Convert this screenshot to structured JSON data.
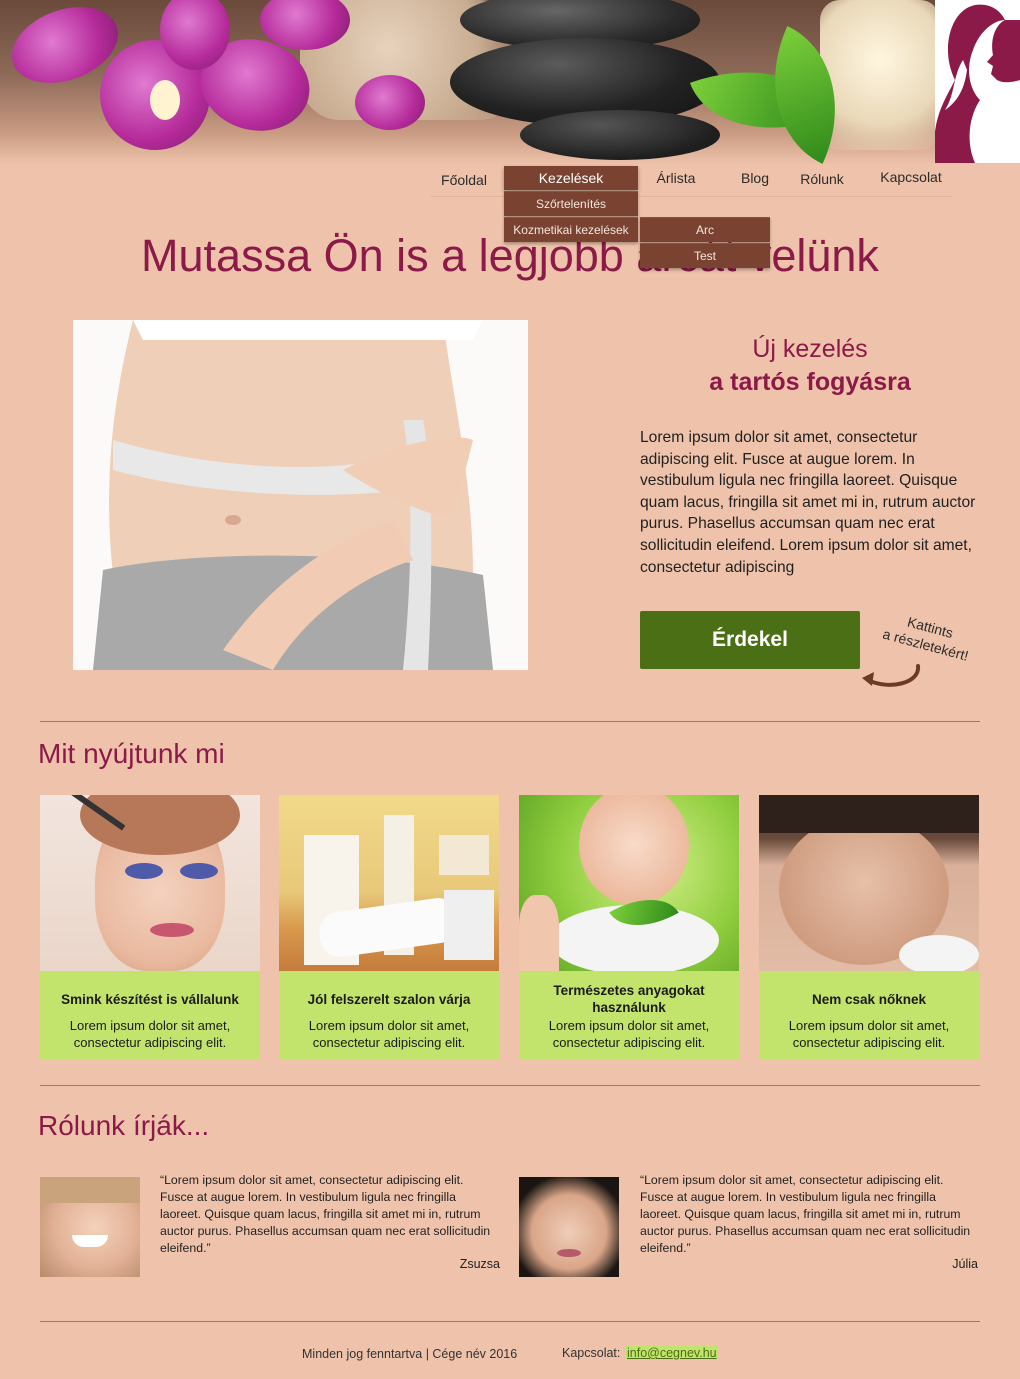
{
  "nav": {
    "items": [
      {
        "label": "Főoldal"
      },
      {
        "label": "Kezelések"
      },
      {
        "label": "Árlista"
      },
      {
        "label": "Blog"
      },
      {
        "label": "Rólunk"
      },
      {
        "label": "Kapcsolat"
      }
    ],
    "dropdown": [
      {
        "label": "Szőrtelenítés"
      },
      {
        "label": "Kozmetikai kezelések"
      }
    ],
    "subdropdown": [
      {
        "label": "Arc"
      },
      {
        "label": "Test"
      }
    ]
  },
  "hero": {
    "title": "Mutassa Ön is a legjobb arcát velünk",
    "side_title_1": "Új kezelés",
    "side_title_2": "a tartós fogyásra",
    "text": "Lorem ipsum dolor sit amet, consectetur adipiscing elit. Fusce at augue lorem. In vestibulum ligula nec fringilla laoreet. Quisque quam lacus, fringilla sit amet mi in, rutrum auctor purus. Phasellus accumsan quam nec erat sollicitudin eleifend. Lorem ipsum dolor sit amet, consectetur adipiscing",
    "cta": "Érdekel",
    "cta_note_1": "Kattints",
    "cta_note_2": "a részletekért!"
  },
  "services": {
    "title": "Mit nyújtunk mi",
    "cards": [
      {
        "title": "Smink készítést is vállalunk",
        "desc": "Lorem ipsum dolor sit amet, consectetur adipiscing elit."
      },
      {
        "title": "Jól felszerelt szalon várja",
        "desc": "Lorem ipsum dolor sit amet, consectetur adipiscing elit."
      },
      {
        "title": "Természetes anyagokat használunk",
        "desc": "Lorem ipsum dolor sit amet, consectetur adipiscing elit."
      },
      {
        "title": "Nem csak nőknek",
        "desc": "Lorem ipsum dolor sit amet, consectetur adipiscing elit."
      }
    ]
  },
  "testimonials": {
    "title": "Rólunk írják...",
    "items": [
      {
        "quote": "“Lorem ipsum dolor sit amet, consectetur adipiscing elit. Fusce at augue lorem. In vestibulum ligula nec fringilla laoreet. Quisque quam lacus, fringilla sit amet mi in, rutrum auctor purus. Phasellus accumsan quam nec erat sollicitudin eleifend.”",
        "author": "Zsuzsa"
      },
      {
        "quote": "“Lorem ipsum dolor sit amet, consectetur adipiscing elit. Fusce at augue lorem. In vestibulum ligula nec fringilla laoreet. Quisque quam lacus, fringilla sit amet mi in, rutrum auctor purus. Phasellus accumsan quam nec erat sollicitudin eleifend.”",
        "author": "Júlia"
      }
    ]
  },
  "footer": {
    "copyright": "Minden jog fenntartva | Cége név 2016",
    "contact_label": "Kapcsolat:",
    "email": "info@cegnev.hu"
  },
  "colors": {
    "background": "#efc3ab",
    "accent": "#8b1a48",
    "nav_active": "#7a4331",
    "cta": "#4b6f15",
    "card": "#c2e46c"
  }
}
